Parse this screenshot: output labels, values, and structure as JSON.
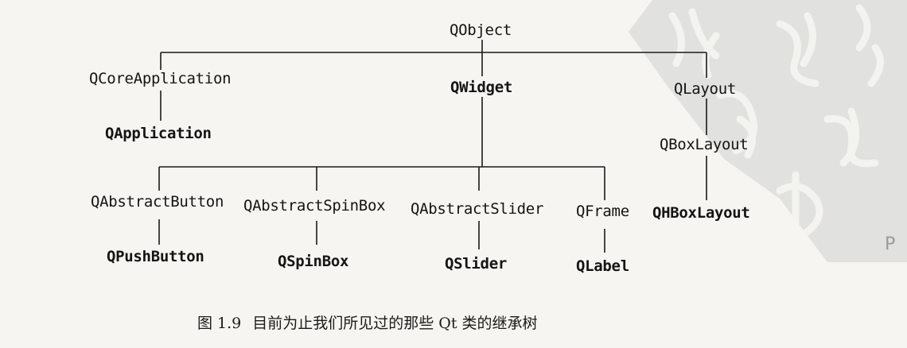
{
  "diagram": {
    "type": "class-inheritance-tree",
    "nodes": [
      {
        "id": "qobject",
        "label": "QObject",
        "bold": false
      },
      {
        "id": "qcoreapplication",
        "label": "QCoreApplication",
        "bold": false
      },
      {
        "id": "qapplication",
        "label": "QApplication",
        "bold": true
      },
      {
        "id": "qwidget",
        "label": "QWidget",
        "bold": true
      },
      {
        "id": "qlayout",
        "label": "QLayout",
        "bold": false
      },
      {
        "id": "qboxlayout",
        "label": "QBoxLayout",
        "bold": false
      },
      {
        "id": "qhboxlayout",
        "label": "QHBoxLayout",
        "bold": true
      },
      {
        "id": "qabstractbutton",
        "label": "QAbstractButton",
        "bold": false
      },
      {
        "id": "qabstractspinbox",
        "label": "QAbstractSpinBox",
        "bold": false
      },
      {
        "id": "qabstractslider",
        "label": "QAbstractSlider",
        "bold": false
      },
      {
        "id": "qframe",
        "label": "QFrame",
        "bold": false
      },
      {
        "id": "qpushbutton",
        "label": "QPushButton",
        "bold": true
      },
      {
        "id": "qspinbox",
        "label": "QSpinBox",
        "bold": true
      },
      {
        "id": "qslider",
        "label": "QSlider",
        "bold": true
      },
      {
        "id": "qlabel",
        "label": "QLabel",
        "bold": true
      }
    ],
    "edges": [
      [
        "qobject",
        "qcoreapplication"
      ],
      [
        "qobject",
        "qwidget"
      ],
      [
        "qobject",
        "qlayout"
      ],
      [
        "qcoreapplication",
        "qapplication"
      ],
      [
        "qlayout",
        "qboxlayout"
      ],
      [
        "qboxlayout",
        "qhboxlayout"
      ],
      [
        "qwidget",
        "qabstractbutton"
      ],
      [
        "qwidget",
        "qabstractspinbox"
      ],
      [
        "qwidget",
        "qabstractslider"
      ],
      [
        "qwidget",
        "qframe"
      ],
      [
        "qabstractbutton",
        "qpushbutton"
      ],
      [
        "qabstractspinbox",
        "qspinbox"
      ],
      [
        "qabstractslider",
        "qslider"
      ],
      [
        "qframe",
        "qlabel"
      ]
    ]
  },
  "caption": {
    "number": "图 1.9",
    "text": "目前为止我们所见过的那些 Qt 类的继承树"
  },
  "colors": {
    "ink": "#141414",
    "paper": "#f6f5f1",
    "seal_fill": "#c9c9c9"
  }
}
